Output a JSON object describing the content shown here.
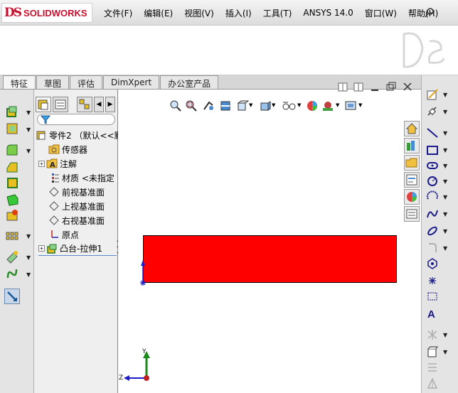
{
  "app": {
    "logo_text": "SOLIDWORKS",
    "logo_mark": "DS"
  },
  "menu": [
    {
      "label": "文件(F)"
    },
    {
      "label": "编辑(E)"
    },
    {
      "label": "视图(V)"
    },
    {
      "label": "插入(I)"
    },
    {
      "label": "工具(T)"
    },
    {
      "label": "ANSYS 14.0"
    },
    {
      "label": "窗口(W)"
    },
    {
      "label": "帮助(H)"
    }
  ],
  "command_tabs": [
    {
      "label": "特征"
    },
    {
      "label": "草图"
    },
    {
      "label": "评估"
    },
    {
      "label": "DimXpert"
    },
    {
      "label": "办公室产品"
    }
  ],
  "tree": {
    "part": "零件2 （默认<<默",
    "items": [
      {
        "label": "传感器"
      },
      {
        "label": "注解"
      },
      {
        "label": "材质 <未指定"
      },
      {
        "label": "前视基准面"
      },
      {
        "label": "上视基准面"
      },
      {
        "label": "右视基准面"
      },
      {
        "label": "原点"
      },
      {
        "label": "凸台-拉伸1"
      }
    ]
  },
  "triad": {
    "y_label": "Y",
    "z_label": "Z"
  },
  "colors": {
    "extrusion": "#ff0000",
    "brand": "#c8102e",
    "axis_y": "#1a8a1a",
    "axis_z": "#1a1acc",
    "origin": "#2020cc"
  }
}
